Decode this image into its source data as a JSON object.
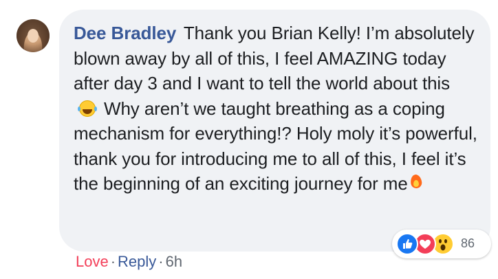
{
  "comment": {
    "author": "Dee Bradley",
    "text_part1": "Thank you Brian Kelly! I’m absolutely blown away by all of this, I feel AMAZING today after day 3 and I want to tell the world about this",
    "text_part2": "Why aren’t we taught breathing as a coping mechanism for everything!? Holy moly it’s powerful, thank you for introducing me to all of this, I feel it’s the beginning of an exciting journey for me"
  },
  "reactions": {
    "count": "86",
    "types": [
      "like-icon",
      "love-icon",
      "wow-icon"
    ]
  },
  "actions": {
    "love_label": "Love",
    "reply_label": "Reply",
    "separator": "·",
    "time": "6h"
  },
  "colors": {
    "author": "#385898",
    "love": "#f33e58",
    "like": "#1877f2",
    "bubble": "#f0f2f5"
  }
}
